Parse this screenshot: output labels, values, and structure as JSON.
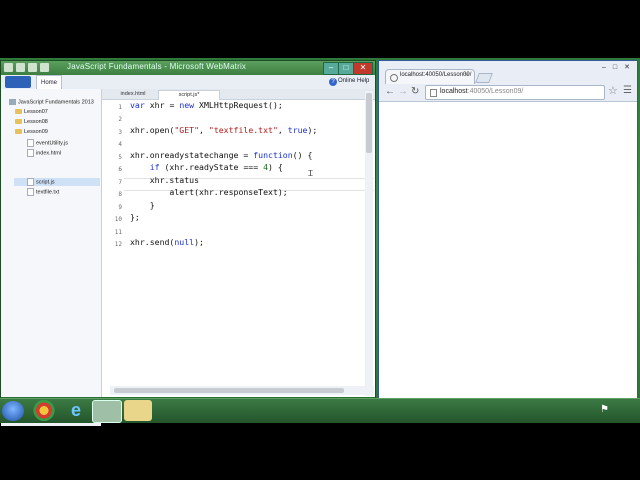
{
  "editor": {
    "window_title": "JavaScript Fundamentals - Microsoft WebMatrix",
    "ribbon_tab_home": "Home",
    "online_help": "Online Help",
    "tree": [
      {
        "label": "JavaScript Fundamentals 2013",
        "type": "site"
      },
      {
        "label": "Lesson07",
        "type": "folder"
      },
      {
        "label": "Lesson08",
        "type": "folder"
      },
      {
        "label": "Lesson09",
        "type": "folder"
      },
      {
        "label": "eventUtility.js",
        "type": "file"
      },
      {
        "label": "index.html",
        "type": "file"
      },
      {
        "label": "script.js",
        "type": "file",
        "selected": true
      },
      {
        "label": "textfile.txt",
        "type": "file"
      }
    ],
    "tabs": [
      {
        "label": "index.html"
      },
      {
        "label": "script.js*"
      }
    ],
    "line_numbers": [
      "1",
      "2",
      "3",
      "4",
      "5",
      "6",
      "7",
      "8",
      "9",
      "10",
      "11",
      "12"
    ],
    "code": {
      "l1": [
        "var",
        " xhr = ",
        "new",
        " XMLHttpRequest();"
      ],
      "l3": [
        "xhr.open(",
        "\"GET\"",
        ", ",
        "\"textfile.txt\"",
        ", ",
        "true",
        ");"
      ],
      "l5": [
        "xhr.onreadystatechange = ",
        "function",
        "() {"
      ],
      "l6": [
        "    ",
        "if",
        " (xhr.readyState === ",
        "4",
        ") {"
      ],
      "l7": [
        "    xhr.status"
      ],
      "l8": [
        "        alert(xhr.responseText);"
      ],
      "l9": [
        "    }"
      ],
      "l10": [
        "};"
      ],
      "l12": [
        "xhr.send(",
        "null",
        ");"
      ]
    }
  },
  "browser": {
    "tab_title": "localhost:40050/Lesson09/",
    "url_host": "localhost",
    "url_rest": ":40050/Lesson09/"
  },
  "icons": {
    "nav_back": "back-arrow-icon",
    "nav_forward": "forward-arrow-icon",
    "reload": "reload-icon",
    "bookmark": "star-icon",
    "settings": "wrench-icon"
  }
}
